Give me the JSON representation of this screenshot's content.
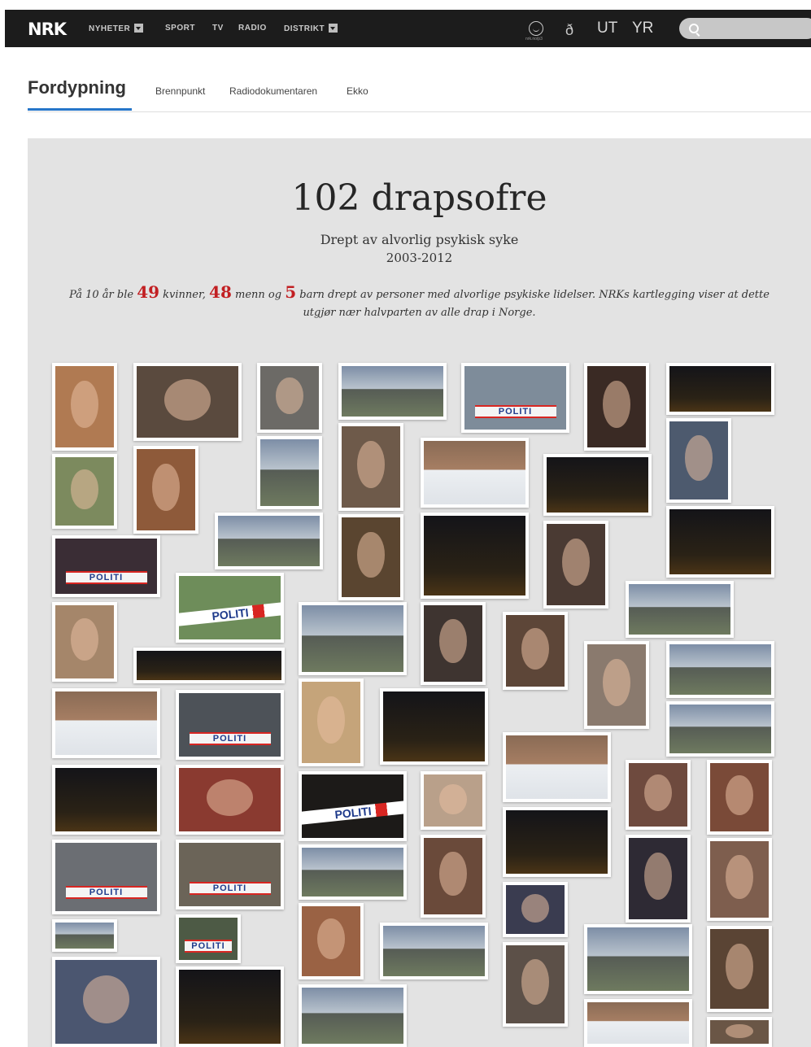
{
  "nav": {
    "logo": "NRK",
    "items": [
      "NYHETER",
      "SPORT",
      "TV",
      "RADIO",
      "DISTRIKT"
    ],
    "emoji_caption": "nrk.no/p3",
    "brands": [
      "UT",
      "YR"
    ],
    "search_placeholder": ""
  },
  "section": {
    "title": "Fordypning",
    "links": [
      "Brennpunkt",
      "Radiodokumentaren",
      "Ekko"
    ]
  },
  "article": {
    "title": "102 drapsofre",
    "subtitle": "Drept av alvorlig psykisk syke",
    "years": "2003-2012",
    "intro": {
      "part1": "På 10 år ble ",
      "women": "49",
      "part2": " kvinner, ",
      "men": "48",
      "part3": " menn og ",
      "children": "5",
      "part4": " barn drept av personer med alvorlige psykiske lidelser. NRKs kartlegging viser at dette utgjør nær halvparten av alle drap i Norge."
    }
  },
  "colors": {
    "nav_bg": "#1c1c1c",
    "accent": "#2676c9",
    "highlight": "#c21f22",
    "panel_bg": "#e3e3e3"
  }
}
